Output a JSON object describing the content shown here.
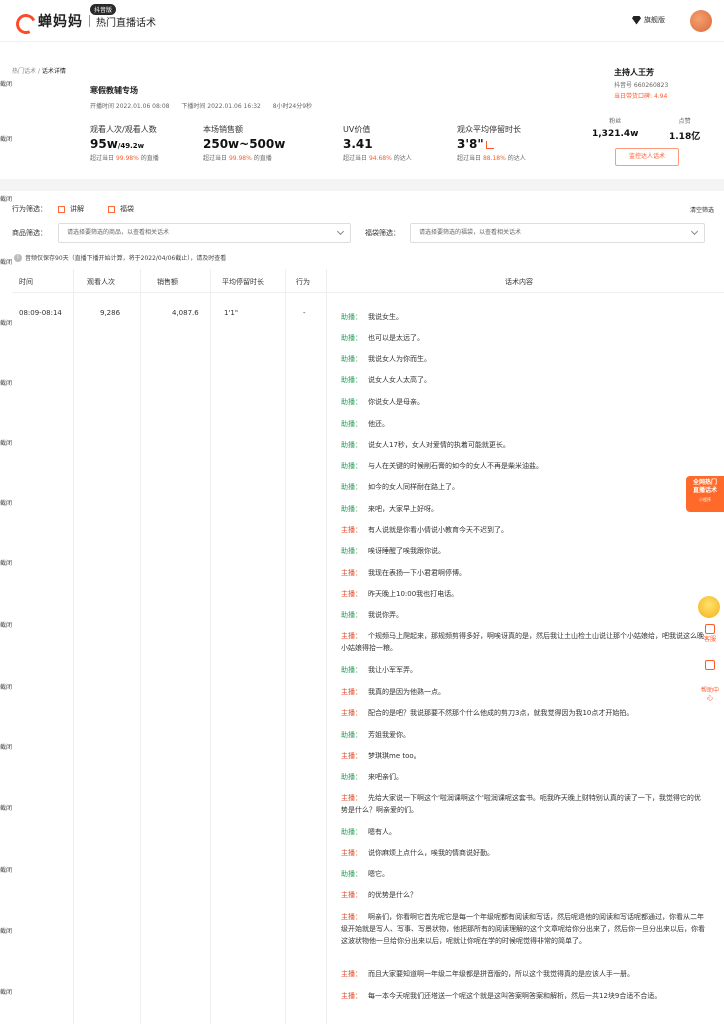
{
  "header": {
    "logo_text": "蝉妈妈",
    "logo_badge": "抖音版",
    "subtitle": "热门直播话术",
    "vip_label": "旗舰版"
  },
  "side_label": "截闭",
  "breadcrumb": {
    "parent": "热门话术",
    "sep": " / ",
    "current": "话术详情"
  },
  "live": {
    "title": "寒假教辅专场",
    "start": "开播时间  2022.01.06 08:08",
    "end": "下播时间  2022.01.06 16:32",
    "duration": "8小时24分9秒"
  },
  "stats": [
    {
      "label": "观看人次/观看人数",
      "value": "95w",
      "value_small": "/49.2w",
      "cmp_prefix": "超过当日",
      "cmp_pct": "99.98%",
      "cmp_suffix": "的直播"
    },
    {
      "label": "本场销售额",
      "value": "250w~500w",
      "value_small": "",
      "cmp_prefix": "超过当日",
      "cmp_pct": "99.98%",
      "cmp_suffix": "的直播"
    },
    {
      "label": "UV价值",
      "value": "3.41",
      "value_small": "",
      "cmp_prefix": "超过当日",
      "cmp_pct": "94.68%",
      "cmp_suffix": "的达人"
    },
    {
      "label": "观众平均停留时长",
      "value": "3'8\"",
      "value_small": "",
      "cmp_prefix": "超过当日",
      "cmp_pct": "88.18%",
      "cmp_suffix": "的达人"
    }
  ],
  "host": {
    "name": "主持人王芳",
    "account": "抖音号 660260823",
    "reputation_label": "当日带货口碑:",
    "reputation_value": "4.94",
    "fans_label": "粉丝",
    "fans_value": "1,321.4w",
    "likes_label": "点赞",
    "likes_value": "1.18亿",
    "monitor_label": "监控达人话术"
  },
  "filters": {
    "behavior_label": "行为筛选：",
    "opt1": "讲解",
    "opt2": "福袋",
    "clear": "清空筛选",
    "product_label": "商品筛选：",
    "product_placeholder": "请选择要筛选的商品，以查看相关话术",
    "bag_label": "福袋筛选：",
    "bag_placeholder": "请选择要筛选的福袋，以查看相关话术",
    "note": "音频仅保存90天（直播下播开始计算，将于2022/04/06截止），请及时查看"
  },
  "table": {
    "headers": [
      "时间",
      "观看人次",
      "销售额",
      "平均停留时长",
      "行为",
      "话术内容"
    ],
    "row": {
      "time": "08:09-08:14",
      "views": "9,286",
      "sales": "4,087.6",
      "stay": "1'1\"",
      "action": "-"
    }
  },
  "roles": {
    "asst": "助播：",
    "host": "主播："
  },
  "speech": [
    {
      "role": "asst",
      "text": "我说女生。"
    },
    {
      "role": "asst",
      "text": "也可以是太远了。"
    },
    {
      "role": "asst",
      "text": "我说女人为你而生。"
    },
    {
      "role": "asst",
      "text": "说女人女人太高了。"
    },
    {
      "role": "asst",
      "text": "你说女人是母亲。"
    },
    {
      "role": "asst",
      "text": "他还。"
    },
    {
      "role": "asst",
      "text": "说女人17秒，女人对爱情的执着可能就更长。"
    },
    {
      "role": "asst",
      "text": "与人在关键的时候削石膏的如今的女人不再是柴米油盐。"
    },
    {
      "role": "asst",
      "text": "如今的女人同样耐在路上了。"
    },
    {
      "role": "asst",
      "text": "来吧，大家早上好呀。"
    },
    {
      "role": "host",
      "text": "有人说就是你看小倩说小教育今天不迟到了。"
    },
    {
      "role": "asst",
      "text": "唉讶睡醒了唉我跟你说。"
    },
    {
      "role": "host",
      "text": "我现在表扬一下小君君啊停博。"
    },
    {
      "role": "host",
      "text": "昨天晚上10:00我也打电话。"
    },
    {
      "role": "asst",
      "text": "我说你弄。"
    },
    {
      "role": "host",
      "text": "个规频马上爬起来，那规频剪得多好，啊唉讶真的是，然后我让土山检土山说让那个小姑娘给，吧我说这么晚小姑娘得拾一粮。"
    },
    {
      "role": "asst",
      "text": "我让小军军弄。"
    },
    {
      "role": "host",
      "text": "我真的是因为他熟一点。"
    },
    {
      "role": "host",
      "text": "配合的是吧？我说那要不然那个什么他成的剪刀3点，就我觉得因为我10点才开始拍。"
    },
    {
      "role": "asst",
      "text": "芳姐我爱你。"
    },
    {
      "role": "host",
      "text": "梦琪琪me too。"
    },
    {
      "role": "asst",
      "text": "来吧亲们。"
    },
    {
      "role": "host",
      "text": "先给大家说一下啊这个'啦润课啊这个'啦润课呢这套书。呃我昨天晚上财特别认真的读了一下，我觉得它的优势是什么？啊亲爱的们。"
    },
    {
      "role": "asst",
      "text": "嗯有人。"
    },
    {
      "role": "host",
      "text": "说你麻烦上点什么，唉我的情商说好勤。"
    },
    {
      "role": "asst",
      "text": "嗯它。"
    },
    {
      "role": "host",
      "text": "的优势是什么？"
    },
    {
      "role": "host",
      "text": "啊亲们，你看啊它首先呢它是每一个年级呢都有阅读和写话，然后呢退他的阅读和写话呢都通过，你看从二年级开始就是写人、写事、写景状物，他把那所有的阅读理解的这个文章呢给你分出来了，然后你一旦分出来以后，你看这波状物他一旦给你分出来以后，呢就让你呢在学的时候呢觉得非常的简单了。"
    },
    {
      "role": "host",
      "text": "而且大家要知道啊一年级二年级都是拼音版的，所以这个我觉得真的是应该人手一册。"
    },
    {
      "role": "host",
      "text": "每一本今天呢我们还塔送一个呢这个就是这叫答案啊答案和解析，然后一共12块9合适不合适。"
    }
  ],
  "float": {
    "card_line1": "全网热门",
    "card_line2": "直播话术",
    "card_small": "小程序",
    "tool1": "客服",
    "tool2": "帮助中心"
  }
}
